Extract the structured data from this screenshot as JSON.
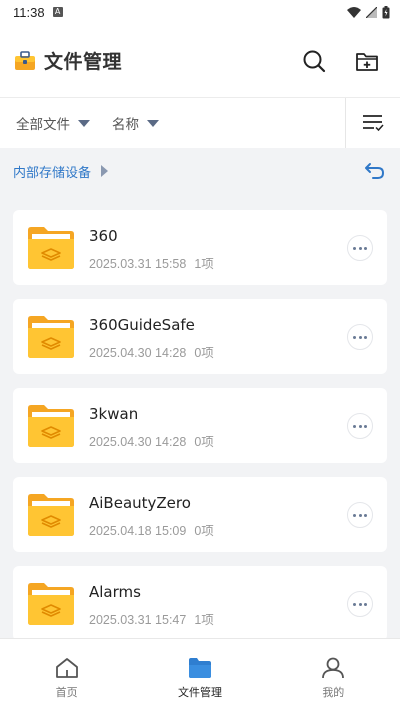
{
  "status_bar": {
    "time": "11:38",
    "notification_icon": "a-icon",
    "right_icons": [
      "wifi-icon",
      "signal-icon",
      "battery-icon"
    ]
  },
  "header": {
    "app_icon": "toolbox-icon",
    "title": "文件管理",
    "search_icon": "search-icon",
    "new_folder_icon": "new-folder-icon"
  },
  "sort_bar": {
    "filter_label": "全部文件",
    "sort_label": "名称",
    "view_icon": "list-sort-icon"
  },
  "breadcrumb": {
    "path": "内部存储设备",
    "back_icon": "undo-arrow-icon"
  },
  "files": [
    {
      "name": "360",
      "date": "2025.03.31 15:58",
      "count": "1项"
    },
    {
      "name": "360GuideSafe",
      "date": "2025.04.30 14:28",
      "count": "0项"
    },
    {
      "name": "3kwan",
      "date": "2025.04.30 14:28",
      "count": "0项"
    },
    {
      "name": "AiBeautyZero",
      "date": "2025.04.18 15:09",
      "count": "0项"
    },
    {
      "name": "Alarms",
      "date": "2025.03.31 15:47",
      "count": "1项"
    }
  ],
  "tab_bar": {
    "tabs": [
      {
        "label": "首页",
        "icon": "home-icon",
        "active": false
      },
      {
        "label": "文件管理",
        "icon": "folder-icon",
        "active": true
      },
      {
        "label": "我的",
        "icon": "person-icon",
        "active": false
      }
    ]
  },
  "colors": {
    "accent": "#3078c8",
    "folder_yellow": "#ffc533",
    "folder_dark": "#f5a623",
    "background": "#f2f3f5"
  }
}
